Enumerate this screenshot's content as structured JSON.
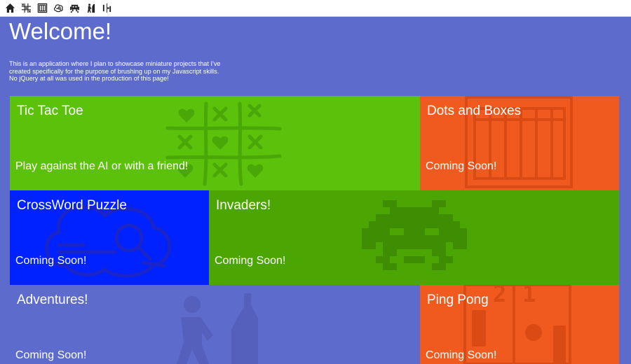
{
  "navbar": {
    "items": [
      {
        "icon": "home-icon"
      },
      {
        "icon": "tic-tac-toe-grid-icon"
      },
      {
        "icon": "dots-and-boxes-icon"
      },
      {
        "icon": "crossword-icon"
      },
      {
        "icon": "invader-icon"
      },
      {
        "icon": "climber-icon"
      },
      {
        "icon": "ping-pong-icon"
      }
    ]
  },
  "page": {
    "title": "Welcome!",
    "intro_lines": [
      "This is an application where I plan to showcase miniature projects that I've",
      "created specifically for the purpose of brushing up on my Javascript skills.",
      "No jQuery at all was used in the production of this page!"
    ]
  },
  "tiles": {
    "tictactoe": {
      "title": "Tic Tac Toe",
      "desc": "Play against the AI or with a friend!",
      "color": "#5cc10a"
    },
    "dots": {
      "title": "Dots and Boxes",
      "desc": "Coming Soon!",
      "color": "#f05a1e"
    },
    "crossword": {
      "title": "CrossWord Puzzle",
      "desc": "Coming Soon!",
      "color": "#0022ff"
    },
    "invaders": {
      "title": "Invaders!",
      "desc": "Coming Soon!",
      "color": "#4ba503"
    },
    "adventures": {
      "title": "Adventures!",
      "desc": "Coming Soon!",
      "color": "#5c6bcc"
    },
    "pingpong": {
      "title": "Ping Pong",
      "desc": "Coming Soon!",
      "color": "#f05a1e",
      "score_left": "2",
      "score_right": "1"
    }
  },
  "colors": {
    "background": "#5c6bcc",
    "navbar": "#ffffff"
  }
}
